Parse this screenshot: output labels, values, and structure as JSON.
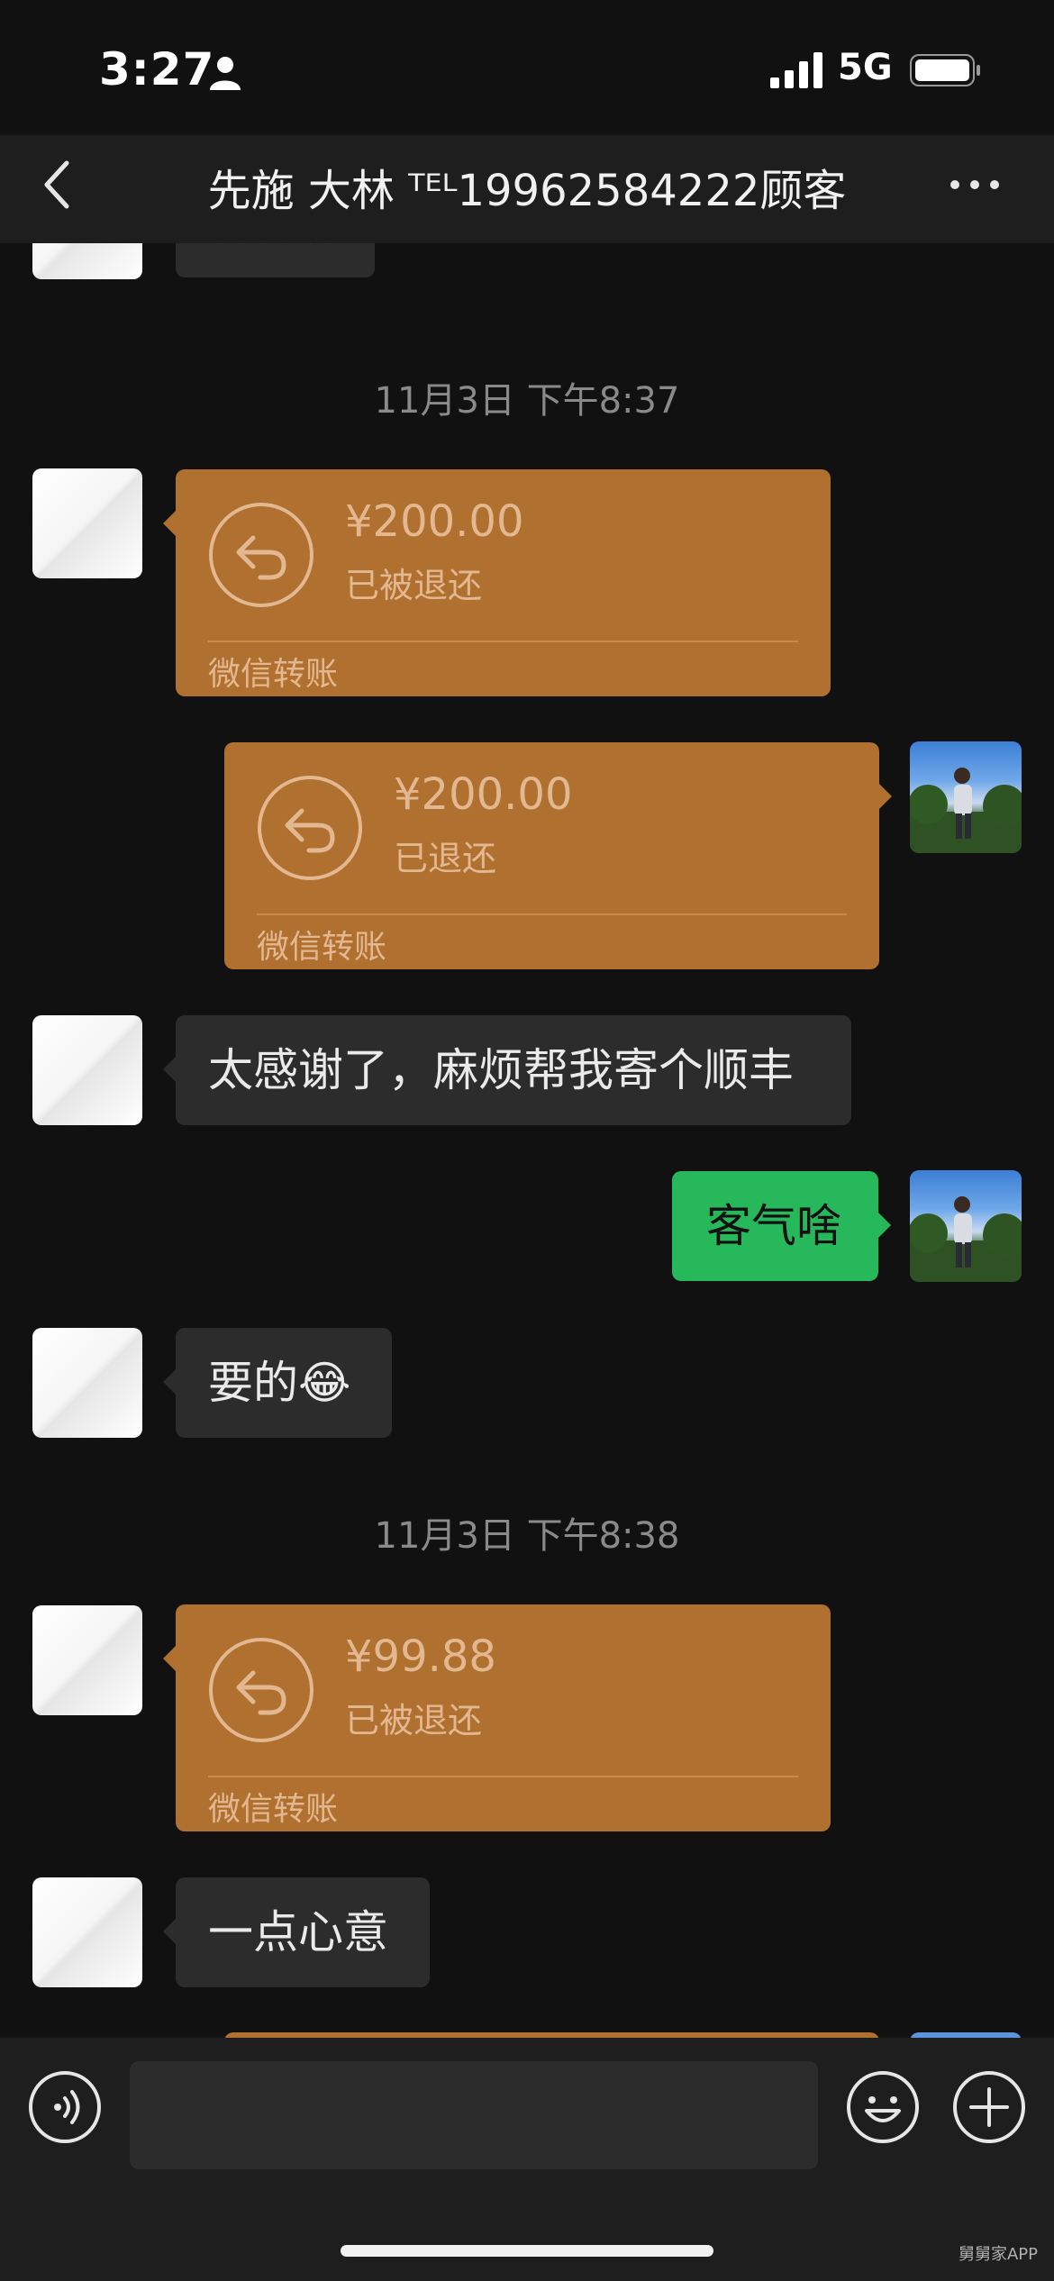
{
  "status_bar": {
    "time": "3:27",
    "network": "5G",
    "icons": [
      "person-icon",
      "signal-icon",
      "battery-icon"
    ]
  },
  "header": {
    "title": "先施 大林 ᵀᴱᴸ19962584222顾客",
    "back_icon": "chevron-left-icon",
    "more_icon": "ellipsis-icon"
  },
  "messages": {
    "partial_top": {
      "text": "🙏🙏🙏"
    },
    "timestamp_1": "11月3日 下午8:37",
    "transfer_1": {
      "amount": "¥200.00",
      "status": "已被退还",
      "source": "微信转账",
      "side": "left"
    },
    "transfer_2": {
      "amount": "¥200.00",
      "status": "已退还",
      "source": "微信转账",
      "side": "right"
    },
    "text_1": {
      "text": "太感谢了，麻烦帮我寄个顺丰",
      "side": "left"
    },
    "text_2": {
      "text": "客气啥",
      "side": "right"
    },
    "text_3": {
      "text": "要的😂",
      "side": "left"
    },
    "timestamp_2": "11月3日 下午8:38",
    "transfer_3": {
      "amount": "¥99.88",
      "status": "已被退还",
      "source": "微信转账",
      "side": "left"
    },
    "text_4": {
      "text": "一点心意",
      "side": "left"
    }
  },
  "input_bar": {
    "placeholder": "",
    "icons": [
      "voice-icon",
      "emoji-icon",
      "plus-icon"
    ]
  },
  "watermark": "舅舅家APP",
  "colors": {
    "background": "#111111",
    "transfer_card": "#b0702f",
    "own_bubble": "#27b85c",
    "other_bubble": "#2c2c2c"
  }
}
